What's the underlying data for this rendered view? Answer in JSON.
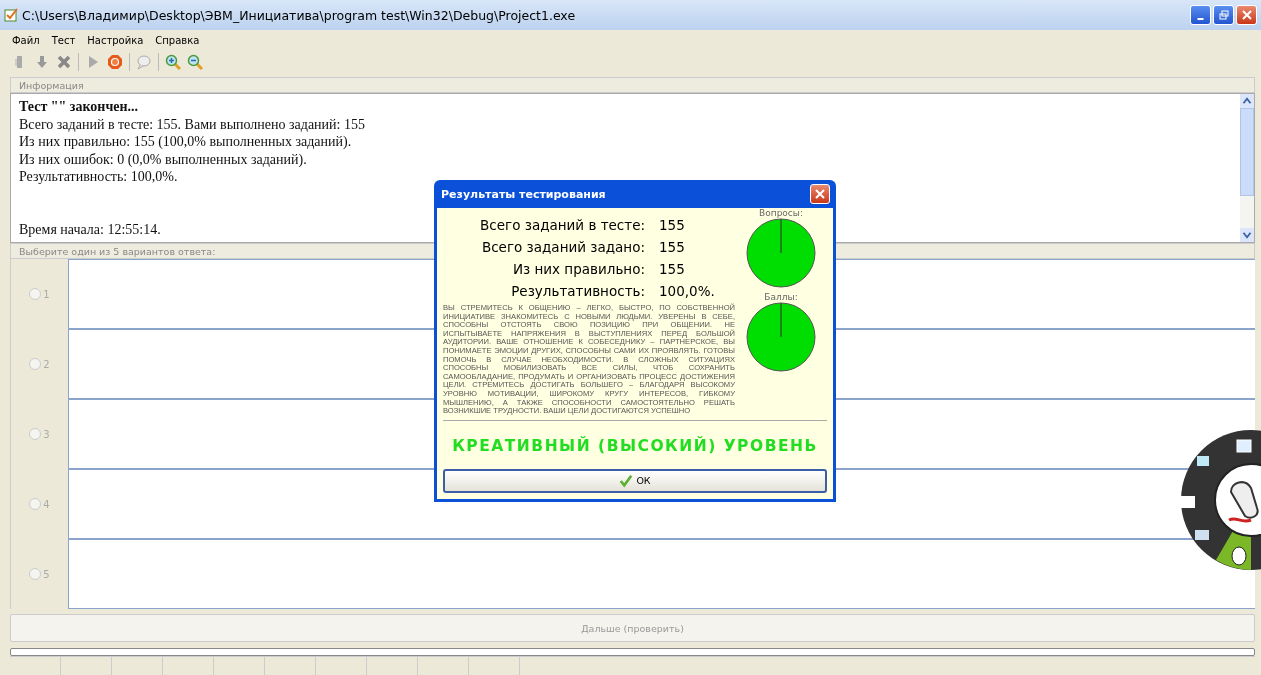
{
  "window": {
    "title": "C:\\Users\\Владимир\\Desktop\\ЭВМ_Инициатива\\program test\\Win32\\Debug\\Project1.exe"
  },
  "menu": [
    "Файл",
    "Тест",
    "Настройка",
    "Справка"
  ],
  "toolbar": [
    {
      "kind": "open",
      "disabled": true
    },
    {
      "kind": "down",
      "disabled": true
    },
    {
      "kind": "delete",
      "disabled": true
    },
    {
      "kind": "separator"
    },
    {
      "kind": "play",
      "disabled": true
    },
    {
      "kind": "stop",
      "disabled": false
    },
    {
      "kind": "separator"
    },
    {
      "kind": "chat",
      "disabled": true
    },
    {
      "kind": "separator"
    },
    {
      "kind": "zoom-in",
      "disabled": false
    },
    {
      "kind": "zoom-out",
      "disabled": false
    }
  ],
  "info": {
    "header": "Информация",
    "title": "Тест \"\" закончен...",
    "lines": [
      "Всего заданий в тесте: 155. Вами выполнено заданий: 155",
      "Из них правильно:  155 (100,0% выполненных заданий).",
      "Из них ошибок: 0 (0,0% выполненных заданий).",
      "Результативность: 100,0%."
    ],
    "lines_after": [
      "Время начала: 12:55:14."
    ]
  },
  "answers": {
    "header": "Выберите один из 5 вариантов ответа:",
    "options": [
      {
        "label": "1",
        "selected": false
      },
      {
        "label": "2",
        "selected": false
      },
      {
        "label": "3",
        "selected": false
      },
      {
        "label": "4",
        "selected": false
      },
      {
        "label": "5",
        "selected": false
      }
    ]
  },
  "next_button": {
    "label": "Дальше (проверить)",
    "disabled": true
  },
  "progress": {
    "level": 0
  },
  "dialog": {
    "title": "Результаты тестирования",
    "stats": [
      {
        "label": "Всего заданий в тесте:",
        "value": "155"
      },
      {
        "label": "Всего заданий задано:",
        "value": "155"
      },
      {
        "label": "Из них правильно:",
        "value": "155"
      },
      {
        "label": "Результативность:",
        "value": "100,0%."
      }
    ],
    "charts": [
      {
        "label": "Вопросы:"
      },
      {
        "label": "Баллы:"
      }
    ],
    "description": "ВЫ СТРЕМИТЕСЬ К ОБЩЕНИЮ – ЛЕГКО, БЫСТРО, ПО СОБСТВЕННОЙ ИНИЦИАТИВЕ ЗНАКОМИТЕСЬ С НОВЫМИ ЛЮДЬМИ. УВЕРЕНЫ В СЕБЕ, СПОСОБНЫ ОТСТОЯТЬ СВОЮ ПОЗИЦИЮ ПРИ ОБЩЕНИИ. НЕ ИСПЫТЫВАЕТЕ НАПРЯЖЕНИЯ В ВЫСТУПЛЕНИЯХ ПЕРЕД БОЛЬШОЙ АУДИТОРИИ. ВАШЕ ОТНОШЕНИЕ К СОБЕСЕДНИКУ – ПАРТНЕРСКОЕ, ВЫ ПОНИМАЕТЕ ЭМОЦИИ ДРУГИХ, СПОСОБНЫ САМИ ИХ ПРОЯВЛЯТЬ. ГОТОВЫ ПОМОЧЬ В СЛУЧАЕ НЕОБХОДИМОСТИ. В СЛОЖНЫХ СИТУАЦИЯХ СПОСОБНЫ МОБИЛИЗОВАТЬ ВСЕ СИЛЫ, ЧТОБ СОХРАНИТЬ САМООБЛАДАНИЕ, ПРОДУМАТЬ И ОРГАНИЗОВАТЬ ПРОЦЕСС ДОСТИЖЕНИЯ ЦЕЛИ. СТРЕМИТЕСЬ ДОСТИГАТЬ БОЛЬШЕГО – БЛАГОДАРЯ ВЫСОКОМУ УРОВНЮ МОТИВАЦИИ, ШИРОКОМУ КРУГУ ИНТЕРЕСОВ, ГИБКОМУ МЫШЛЕНИЮ, А ТАКЖЕ СПОСОБНОСТИ САМОСТОЯТЕЛЬНО РЕШАТЬ ВОЗНИКШИЕ ТРУДНОСТИ. ВАШИ ЦЕЛИ ДОСТИГАЮТСЯ УСПЕШНО",
    "level": "КРЕАТИВНЫЙ (ВЫСОКИЙ) УРОВЕНЬ",
    "ok_button": "ОК"
  }
}
